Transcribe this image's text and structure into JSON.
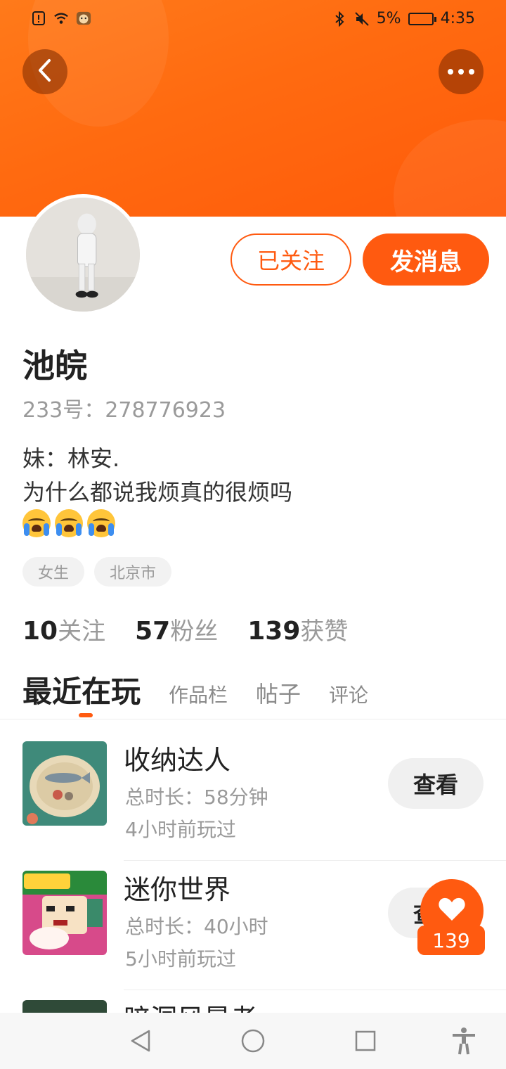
{
  "status_bar": {
    "battery_pct": "5%",
    "time": "4:35",
    "icons": [
      "alert-icon",
      "wifi-icon",
      "app-icon",
      "bluetooth-icon",
      "mute-icon",
      "battery-icon"
    ]
  },
  "header": {
    "back_icon": "chevron-left-icon",
    "more_icon": "more-dots-icon"
  },
  "profile": {
    "follow_label": "已关注",
    "message_label": "发消息",
    "name": "池皖",
    "uid_prefix": "233号：",
    "uid": "278776923",
    "bio_line1": "妹：林安.",
    "bio_line2": "为什么都说我烦真的很烦吗",
    "bio_emojis": [
      "crying-face-emoji",
      "crying-face-emoji",
      "crying-face-emoji"
    ],
    "tags": [
      "女生",
      "北京市"
    ]
  },
  "stats": [
    {
      "value": "10",
      "label": "关注"
    },
    {
      "value": "57",
      "label": "粉丝"
    },
    {
      "value": "139",
      "label": "获赞"
    }
  ],
  "tabs": {
    "active": "最近在玩",
    "others": [
      "作品栏",
      "帖子",
      "评论"
    ]
  },
  "games": [
    {
      "title": "收纳达人",
      "duration": "总时长：58分钟",
      "last_played": "4小时前玩过",
      "button": "查看"
    },
    {
      "title": "迷你世界",
      "duration": "总时长：40小时",
      "last_played": "5小时前玩过",
      "button": "查看"
    },
    {
      "title": "暗洞风暴者",
      "duration": "",
      "last_played": "",
      "button": ""
    }
  ],
  "like_fab": {
    "count": "139",
    "icon": "heart-icon"
  },
  "navbar": [
    "back-triangle-icon",
    "home-circle-icon",
    "recents-square-icon",
    "accessibility-icon"
  ],
  "colors": {
    "accent": "#ff5a10",
    "banner": "#ff6a10",
    "muted": "#9a9a9a"
  }
}
